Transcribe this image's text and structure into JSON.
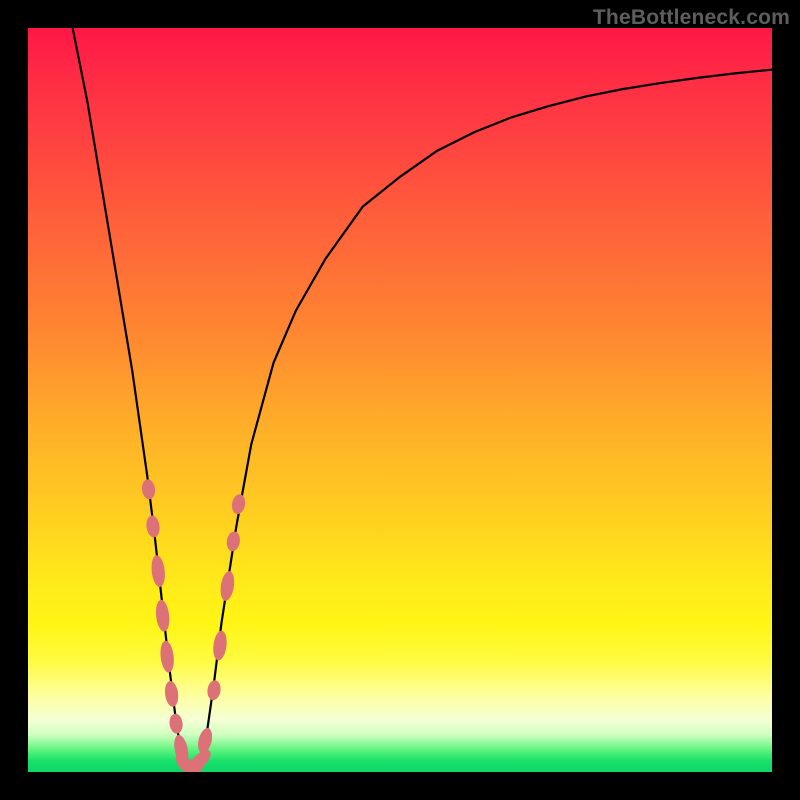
{
  "watermark": "TheBottleneck.com",
  "colors": {
    "frame": "#000000",
    "curve": "#000000",
    "marker": "#dc7277",
    "gradient_top": "#ff1746",
    "gradient_bottom": "#0fd666"
  },
  "chart_data": {
    "type": "line",
    "title": "",
    "xlabel": "",
    "ylabel": "",
    "xlim": [
      0,
      100
    ],
    "ylim": [
      0,
      100
    ],
    "grid": false,
    "legend": false,
    "series": [
      {
        "name": "bottleneck-curve",
        "x": [
          6,
          8,
          10,
          12,
          14,
          16,
          17,
          18,
          19,
          20,
          21,
          22,
          23,
          24,
          25,
          26,
          28,
          30,
          33,
          36,
          40,
          45,
          50,
          55,
          60,
          65,
          70,
          75,
          80,
          85,
          90,
          95,
          100
        ],
        "y": [
          100,
          90,
          78,
          66,
          54,
          40,
          32,
          23,
          14,
          6,
          1,
          0,
          1,
          5,
          12,
          20,
          33,
          44,
          55,
          62,
          69,
          76,
          80,
          83.5,
          86,
          88,
          89.5,
          90.8,
          91.8,
          92.6,
          93.3,
          93.9,
          94.4
        ]
      }
    ],
    "markers": [
      {
        "x": 16.2,
        "y": 38,
        "r": 1.0
      },
      {
        "x": 16.8,
        "y": 33,
        "r": 1.1
      },
      {
        "x": 17.5,
        "y": 27,
        "r": 1.6
      },
      {
        "x": 18.1,
        "y": 21,
        "r": 1.6
      },
      {
        "x": 18.7,
        "y": 15.5,
        "r": 1.6
      },
      {
        "x": 19.3,
        "y": 10.5,
        "r": 1.3
      },
      {
        "x": 19.9,
        "y": 6.5,
        "r": 1.0
      },
      {
        "x": 20.6,
        "y": 3.0,
        "r": 1.5
      },
      {
        "x": 21.4,
        "y": 0.8,
        "r": 1.5
      },
      {
        "x": 22.2,
        "y": 0.3,
        "r": 1.5
      },
      {
        "x": 23.0,
        "y": 1.4,
        "r": 1.5
      },
      {
        "x": 23.8,
        "y": 4.2,
        "r": 1.3
      },
      {
        "x": 25.0,
        "y": 11,
        "r": 1.0
      },
      {
        "x": 25.8,
        "y": 17,
        "r": 1.5
      },
      {
        "x": 26.8,
        "y": 25,
        "r": 1.5
      },
      {
        "x": 27.6,
        "y": 31,
        "r": 1.0
      },
      {
        "x": 28.3,
        "y": 36,
        "r": 1.0
      }
    ]
  }
}
